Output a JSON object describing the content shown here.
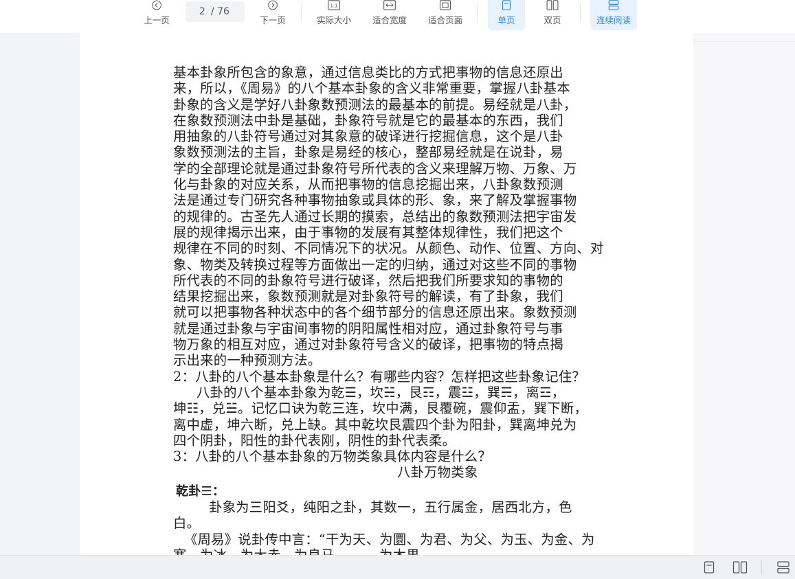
{
  "toolbar": {
    "prev_label": "上一页",
    "page_current": "2",
    "page_total": "/ 76",
    "next_label": "下一页",
    "actual_size_label": "实际大小",
    "fit_width_label": "适合宽度",
    "fit_page_label": "适合页面",
    "single_page_label": "单页",
    "double_page_label": "双页",
    "continuous_label": "连续阅读"
  },
  "document": {
    "lines": [
      "基本卦象所包含的象意，通过信息类比的方式把事物的信息还原出",
      "来，所以，《周易》的八个基本卦象的含义非常重要，掌握八卦基本",
      "卦象的含义是学好八卦象数预测法的最基本的前提。易经就是八卦，",
      "在象数预测法中卦是基础，卦象符号就是它的最基本的东西，我们",
      "用抽象的八卦符号通过对其象意的破译进行挖掘信息，这个是八卦",
      "象数预测法的主旨，卦象是易经的核心，整部易经就是在说卦，易",
      "学的全部理论就是通过卦象符号所代表的含义来理解万物、万象、万",
      "化与卦象的对应关系，从而把事物的信息挖掘出来，八卦象数预测",
      "法是通过专门研究各种事物抽象或具体的形、象，来了解及掌握事物",
      "的规律的。古圣先人通过长期的摸索，总结出的象数预测法把宇宙发",
      "展的规律揭示出来，由于事物的发展有其整体规律性，我们把这个",
      "规律在不同的时刻、不同情况下的状况。从颜色、动作、位置、方向、对",
      "象、物类及转换过程等方面做出一定的归纳，通过对这些不同的事物",
      "所代表的不同的卦象符号进行破译，然后把我们所要求知的事物的",
      "结果挖掘出来，象数预测就是对卦象符号的解读，有了卦象，我们",
      "就可以把事物各种状态中的各个细节部分的信息还原出来。象数预测",
      "就是通过卦象与宇宙间事物的阴阳属性相对应，通过卦象符号与事",
      "物万象的相互对应，通过对卦象符号含义的破译，把事物的特点揭",
      "示出来的一种预测方法。",
      "2：八卦的八个基本卦象是什么？有哪些内容？怎样把这些卦象记住？"
    ],
    "para2": [
      "八卦的八个基本卦象为乾☰，坎☵，艮☶，震☳，巽☴，离☲，",
      "坤☷，兑☱。记忆口诀为乾三连，坎中满，艮覆碗，震仰盂，巽下断，",
      "离中虚，坤六断，兑上缺。其中乾坎艮震四个卦为阳卦，巽离坤兑为",
      "四个阴卦，阳性的卦代表刚，阴性的卦代表柔。"
    ],
    "question3": "3：八卦的八个基本卦象的万物类象具体内容是什么？",
    "section_title": "八卦万物类象",
    "qian_heading": "乾卦☰：",
    "qian_lines": [
      "卦象为三阳爻，纯阳之卦，其数一，五行属金，居西北方，色",
      "白。"
    ],
    "quote_lines": [
      "《周易》说卦传中言：“干为天、为圜、为君、为父、为玉、为金、为",
      "寒、为冰、为大赤、为良马、…… 为木果"
    ]
  },
  "colors": {
    "accent": "#2a8ae6",
    "active_bg": "#e8f2fc"
  }
}
